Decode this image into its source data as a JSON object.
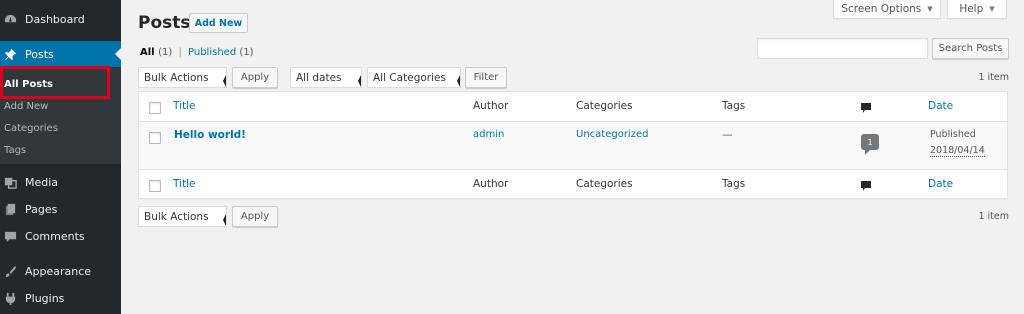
{
  "sidebar": {
    "items": [
      {
        "label": "Dashboard",
        "icon": "dashboard-icon"
      },
      {
        "label": "Posts",
        "icon": "pushpin-icon"
      },
      {
        "label": "Media",
        "icon": "media-icon"
      },
      {
        "label": "Pages",
        "icon": "pages-icon"
      },
      {
        "label": "Comments",
        "icon": "comments-icon"
      },
      {
        "label": "Appearance",
        "icon": "paintbrush-icon"
      },
      {
        "label": "Plugins",
        "icon": "plugins-icon"
      }
    ],
    "submenu": [
      "All Posts",
      "Add New",
      "Categories",
      "Tags"
    ]
  },
  "header": {
    "screen_options": "Screen Options",
    "help": "Help",
    "title": "Posts",
    "add_new": "Add New"
  },
  "views": {
    "all": "All",
    "all_count": "(1)",
    "separator": "|",
    "published": "Published",
    "published_count": "(1)"
  },
  "search": {
    "placeholder": "",
    "button": "Search Posts"
  },
  "tablenav_top": {
    "bulk_actions": "Bulk Actions",
    "apply": "Apply",
    "dates": "All dates",
    "categories": "All Categories",
    "filter": "Filter",
    "count": "1 item"
  },
  "table": {
    "columns": {
      "title": "Title",
      "author": "Author",
      "categories": "Categories",
      "tags": "Tags",
      "date": "Date"
    },
    "rows": [
      {
        "title": "Hello world!",
        "author": "admin",
        "categories": "Uncategorized",
        "tags": "—",
        "comments": "1",
        "status": "Published",
        "date": "2018/04/14"
      }
    ]
  },
  "tablenav_bottom": {
    "bulk_actions": "Bulk Actions",
    "apply": "Apply",
    "count": "1 item"
  },
  "colors": {
    "sidebar_bg": "#23282d",
    "submenu_bg": "#32373c",
    "accent": "#0073aa",
    "highlight_border": "#e0001a",
    "page_bg": "#f1f1f1"
  }
}
